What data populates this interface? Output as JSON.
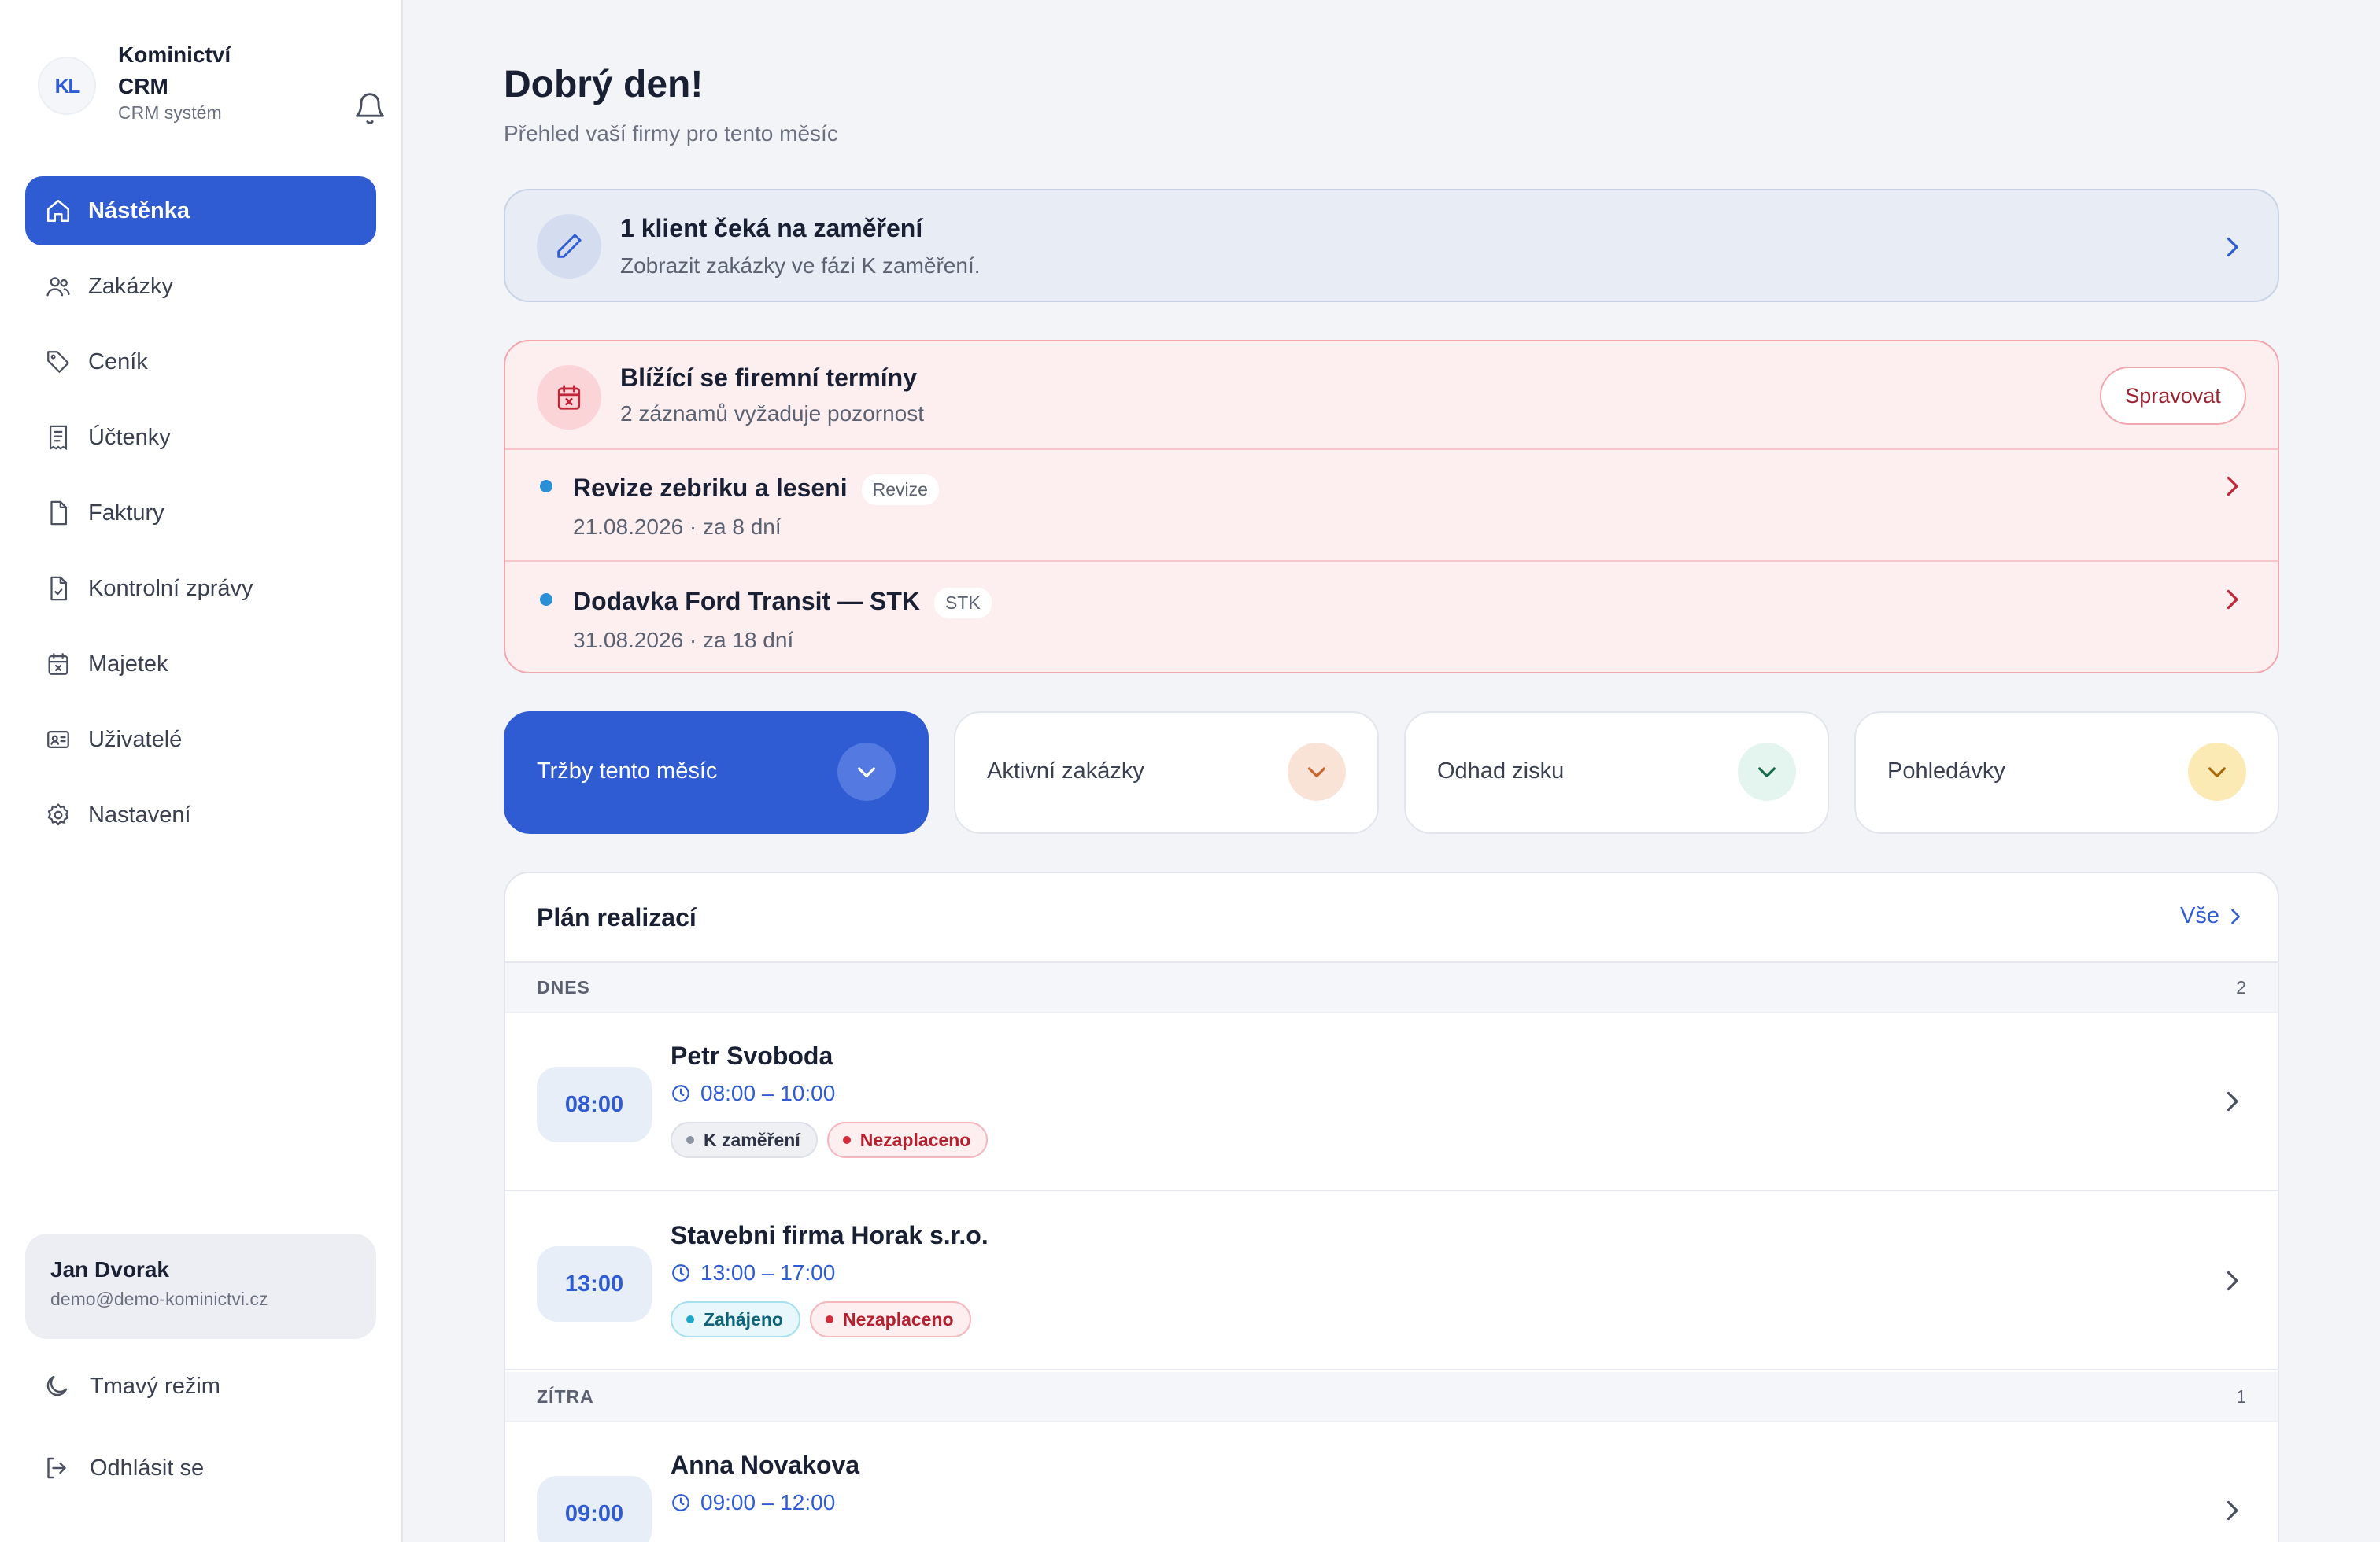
{
  "sidebar": {
    "brand": {
      "logo_text": "KL",
      "name": "Kominictví CRM",
      "subtitle": "CRM systém"
    },
    "items": [
      {
        "label": "Nástěnka",
        "icon": "home-icon",
        "active": true
      },
      {
        "label": "Zakázky",
        "icon": "users-icon"
      },
      {
        "label": "Ceník",
        "icon": "tag-icon"
      },
      {
        "label": "Účtenky",
        "icon": "receipt-icon"
      },
      {
        "label": "Faktury",
        "icon": "file-icon"
      },
      {
        "label": "Kontrolní zprávy",
        "icon": "file-check-icon"
      },
      {
        "label": "Majetek",
        "icon": "calendar-x-icon"
      },
      {
        "label": "Uživatelé",
        "icon": "id-card-icon"
      },
      {
        "label": "Nastavení",
        "icon": "gear-icon"
      }
    ],
    "user": {
      "name": "Jan Dvorak",
      "email": "demo@demo-kominictvi.cz"
    },
    "dark_mode_label": "Tmavý režim",
    "logout_label": "Odhlásit se"
  },
  "header": {
    "greeting": "Dobrý den!",
    "subtitle": "Přehled vaší firmy pro tento měsíc"
  },
  "notice": {
    "title": "1 klient čeká na zaměření",
    "text": "Zobrazit zakázky ve fázi K zaměření."
  },
  "deadlines": {
    "title": "Blížící se firemní termíny",
    "subtitle": "2 záznamů vyžaduje pozornost",
    "manage_label": "Spravovat",
    "items": [
      {
        "name": "Revize zebriku a leseni",
        "tag": "Revize",
        "date": "21.08.2026 · za 8 dní"
      },
      {
        "name": "Dodavka Ford Transit — STK",
        "tag": "STK",
        "date": "31.08.2026 · za 18 dní"
      }
    ]
  },
  "kpis": [
    {
      "label": "Tržby tento měsíc",
      "color": "#2f5bd3"
    },
    {
      "label": "Aktivní zakázky",
      "color": "#f9e3d6"
    },
    {
      "label": "Odhad zisku",
      "color": "#e3f5ee"
    },
    {
      "label": "Pohledávky",
      "color": "#fbeab4"
    }
  ],
  "plan": {
    "title": "Plán realizací",
    "all_label": "Vše",
    "today": {
      "label": "DNES",
      "count": "2"
    },
    "tomorrow": {
      "label": "ZÍTRA",
      "count": "1"
    },
    "jobs": [
      {
        "time": "08:00",
        "name": "Petr Svoboda",
        "range": "08:00 – 10:00",
        "status": "K zaměření",
        "payment": "Nezaplaceno"
      },
      {
        "time": "13:00",
        "name": "Stavebni firma Horak s.r.o.",
        "range": "13:00 – 17:00",
        "status": "Zahájeno",
        "payment": "Nezaplaceno"
      },
      {
        "time": "09:00",
        "name": "Anna Novakova",
        "range": "09:00 – 12:00"
      }
    ]
  }
}
